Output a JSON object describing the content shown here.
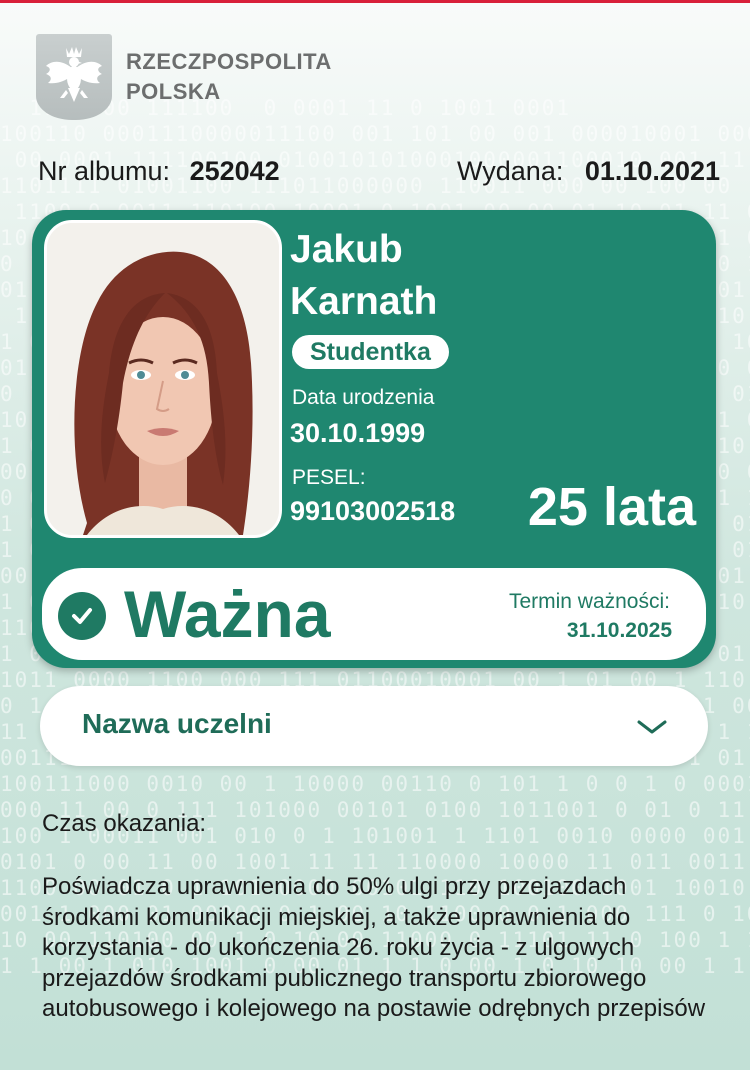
{
  "header": {
    "country_line1": "RZECZPOSPOLITA",
    "country_line2": "POLSKA"
  },
  "info": {
    "album_label": "Nr albumu:",
    "album_value": "252042",
    "issued_label": "Wydana:",
    "issued_value": "01.10.2021"
  },
  "card": {
    "first_name": "Jakub",
    "last_name": "Karnath",
    "role": "Studentka",
    "dob_label": "Data urodzenia",
    "dob_value": "30.10.1999",
    "pesel_label": "PESEL:",
    "pesel_value": "99103002518",
    "age": "25 lata",
    "status": "Ważna",
    "term_label": "Termin ważności:",
    "term_value": "31.10.2025"
  },
  "dropdown": {
    "label": "Nazwa uczelni"
  },
  "body": {
    "czas_label": "Czas okazania:",
    "description": "Poświadcza uprawnienia do 50% ulgi przy przejazdach środkami komunikacji miejskiej, a także uprawnienia do korzystania - do ukończenia 26. roku życia - z ulgowych przejazdów środkami publicznego transportu zbiorowego autobusowego i kolejowego na postawie odrębnych przepisów"
  },
  "colors": {
    "accent": "#1f8770",
    "accent_dark": "#1f7a63",
    "top_line": "#d8203a"
  },
  "icons": {
    "emblem": "white-eagle-emblem-icon",
    "check": "check-circle-icon",
    "chevron": "chevron-down-icon"
  }
}
